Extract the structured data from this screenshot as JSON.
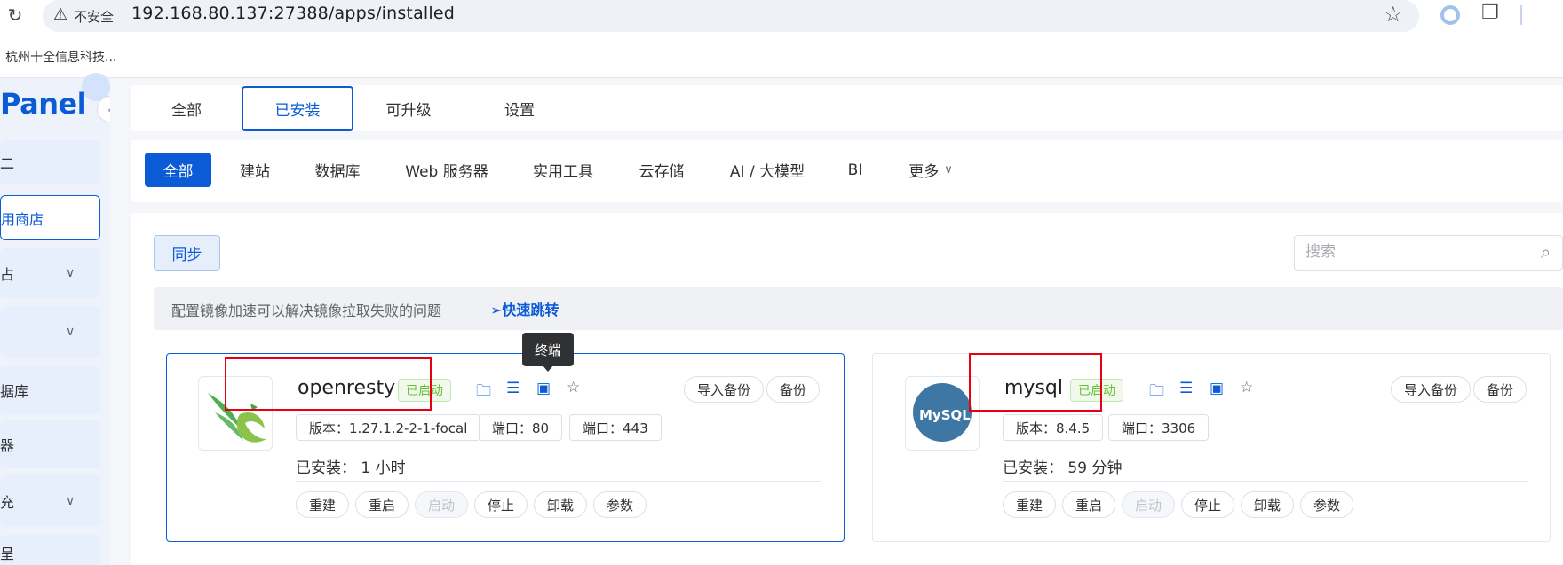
{
  "browser": {
    "security_label": "不安全",
    "url": "192.168.80.137:27388/apps/installed",
    "bookmark": "杭州十全信息科技..."
  },
  "sidebar": {
    "logo": "Panel",
    "items": [
      {
        "label": "⸏",
        "text": "二",
        "has_chevron": false
      },
      {
        "label": "用商店",
        "has_chevron": false,
        "active": true
      },
      {
        "label": "占",
        "has_chevron": true
      },
      {
        "label": "",
        "has_chevron": true
      },
      {
        "label": "据库",
        "has_chevron": false
      },
      {
        "label": "器",
        "has_chevron": false
      },
      {
        "label": "充",
        "has_chevron": true
      },
      {
        "label": "呈",
        "has_chevron": false
      }
    ]
  },
  "top_tabs": [
    "全部",
    "已安装",
    "可升级",
    "设置"
  ],
  "categories": [
    "全部",
    "建站",
    "数据库",
    "Web 服务器",
    "实用工具",
    "云存储",
    "AI / 大模型",
    "BI",
    "更多"
  ],
  "sync_label": "同步",
  "search_placeholder": "搜索",
  "notice": {
    "text": "配置镜像加速可以解决镜像拉取失败的问题",
    "link": "快速跳转"
  },
  "tooltip": "终端",
  "apps": [
    {
      "name": "openresty",
      "status": "已启动",
      "version": "版本：1.27.1.2-2-1-focal",
      "ports": [
        "端口：80",
        "端口：443"
      ],
      "installed": "已安装：  1 小时",
      "actions": [
        "重建",
        "重启",
        "启动",
        "停止",
        "卸载",
        "参数"
      ],
      "backup_actions": [
        "导入备份",
        "备份"
      ]
    },
    {
      "name": "mysql",
      "status": "已启动",
      "version": "版本：8.4.5",
      "ports": [
        "端口：3306"
      ],
      "installed": "已安装：  59 分钟",
      "actions": [
        "重建",
        "重启",
        "启动",
        "停止",
        "卸载",
        "参数"
      ],
      "backup_actions": [
        "导入备份",
        "备份"
      ],
      "logo_text": "MySQL"
    }
  ]
}
